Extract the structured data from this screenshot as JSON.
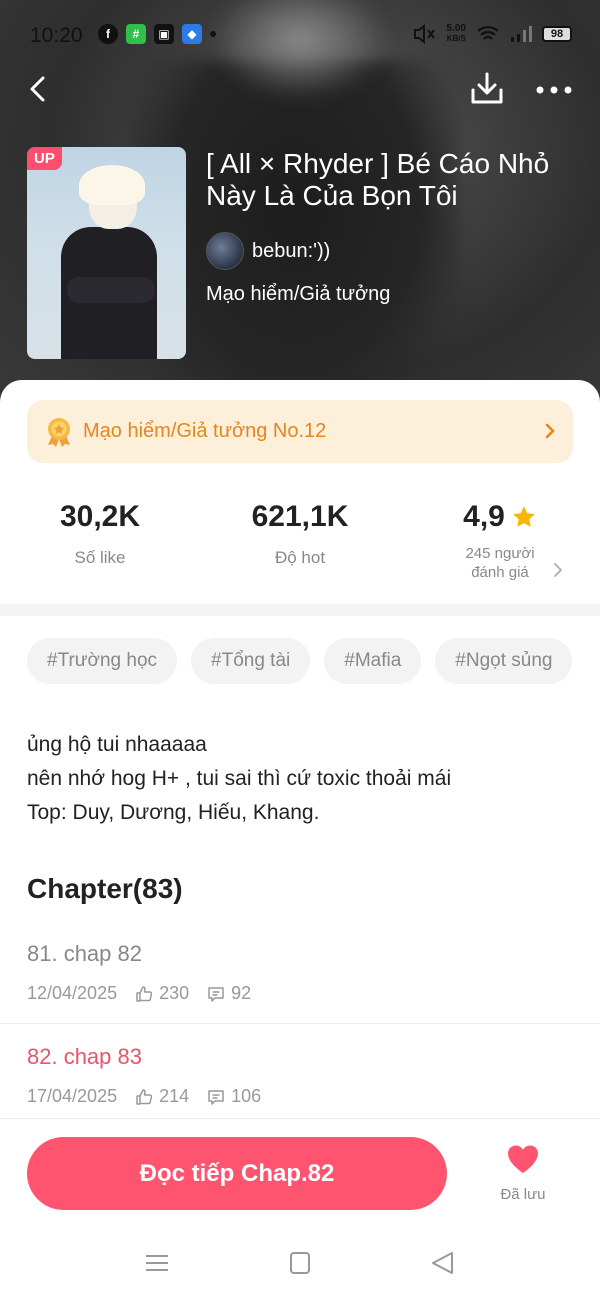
{
  "status_bar": {
    "time": "10:20",
    "speed_top": "5.00",
    "speed_bottom": "KB/S",
    "battery": "98"
  },
  "nav": {
    "back_icon": "chevron-left-icon",
    "download_icon": "download-icon",
    "more_icon": "more-dots-icon"
  },
  "story": {
    "badge": "UP",
    "title": "[ All × Rhyder ] Bé Cáo Nhỏ Này Là Của Bọn Tôi",
    "author": "bebun:'))",
    "genre": "Mạo hiểm/Giả tưởng"
  },
  "rank": {
    "label": "Mạo hiểm/Giả tưởng No.12"
  },
  "stats": {
    "likes_value": "30,2K",
    "likes_label": "Số like",
    "hot_value": "621,1K",
    "hot_label": "Độ hot",
    "rating_value": "4,9",
    "rating_count": "245 người",
    "rating_label": "đánh giá"
  },
  "tags": [
    "#Trường học",
    "#Tổng tài",
    "#Mafia",
    "#Ngọt sủng"
  ],
  "description": {
    "line1": "ủng hộ tui nhaaaaa",
    "line2": "nên nhớ hog H+ , tui sai thì cứ toxic thoải mái",
    "line3": "Top: Duy, Dương, Hiếu, Khang."
  },
  "chapters": {
    "heading": "Chapter(83)",
    "items": [
      {
        "title": "81. chap 82",
        "date": "12/04/2025",
        "likes": "230",
        "comments": "92"
      },
      {
        "title": "82. chap 83",
        "date": "17/04/2025",
        "likes": "214",
        "comments": "106"
      }
    ]
  },
  "actions": {
    "read_label": "Đọc tiếp Chap.82",
    "save_label": "Đã lưu"
  },
  "colors": {
    "accent": "#ff5470",
    "rank_text": "#e8841d",
    "rank_bg": "#fdf0da",
    "star": "#f5b700",
    "read_chapter": "#888888",
    "current_chapter": "#e8546b"
  }
}
